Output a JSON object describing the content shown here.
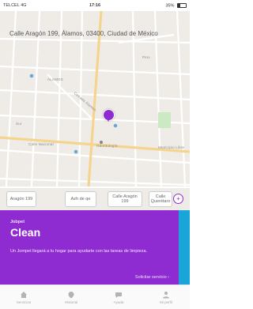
{
  "status_bar": {
    "carrier": "TELCEL 4G",
    "time": "17:16",
    "battery": "35%"
  },
  "map": {
    "address": "Calle Aragón 199, Álamos, 03400, Ciudad de México",
    "labels": [
      "ÁLAMOS",
      "Cerrada Álamos",
      "Pino",
      "Sur",
      "Odontología",
      "Calle Nacional",
      "Municipio Libre"
    ]
  },
  "chips": [
    {
      "label": "Aragón 199"
    },
    {
      "label": "Azh de qe"
    },
    {
      "label": "Calle Aragón 199"
    },
    {
      "label": "Calle Querétaro"
    }
  ],
  "service_card": {
    "brand": "Jobpet",
    "title": "Clean",
    "description": "Un Jompet llegará a tu hogar para ayudarte con las tareas de limpieza.",
    "request_label": "Solicitar servicio ›"
  },
  "tabs": [
    {
      "label": "Servicios",
      "icon": "home-icon"
    },
    {
      "label": "Historial",
      "icon": "history-icon"
    },
    {
      "label": "Ayuda",
      "icon": "chat-icon"
    },
    {
      "label": "Mi perfil",
      "icon": "user-icon"
    }
  ],
  "colors": {
    "brand_purple": "#8e2bd1",
    "accent_blue": "#1aa5d9",
    "map_bg": "#efece8"
  }
}
